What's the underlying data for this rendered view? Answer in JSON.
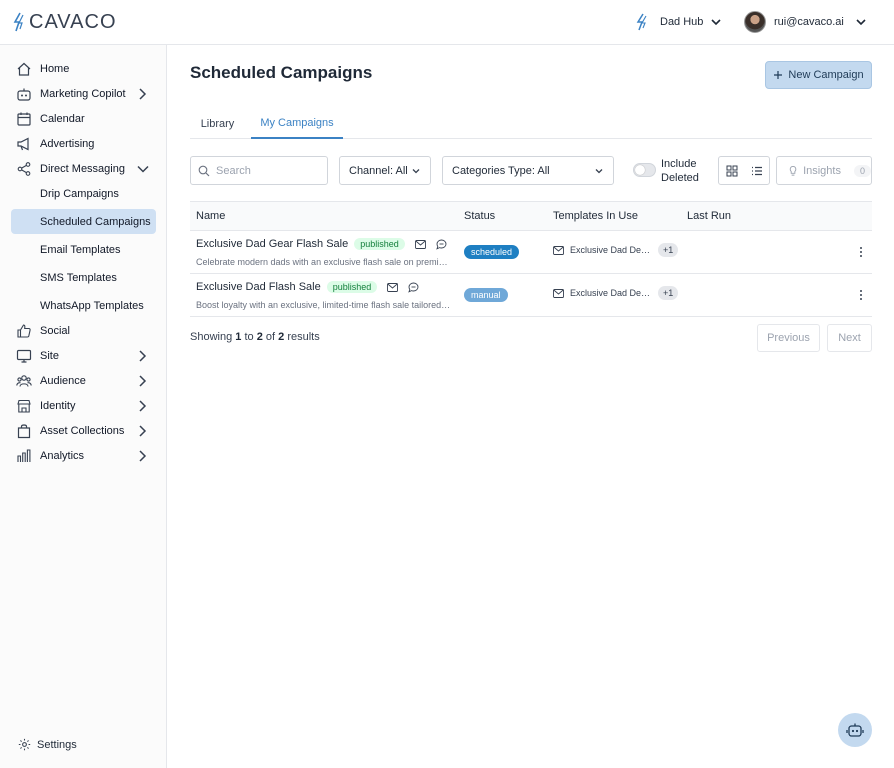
{
  "brand": {
    "name": "CAVACO",
    "accent": "#3b82c4"
  },
  "header": {
    "hub_label": "Dad Hub",
    "user_email": "rui@cavaco.ai"
  },
  "sidebar": {
    "items": [
      {
        "label": "Home",
        "icon": "home-icon"
      },
      {
        "label": "Marketing Copilot",
        "icon": "robot-icon"
      },
      {
        "label": "Calendar",
        "icon": "calendar-icon"
      },
      {
        "label": "Advertising",
        "icon": "megaphone-icon"
      },
      {
        "label": "Direct Messaging",
        "icon": "share-icon"
      },
      {
        "label": "Social",
        "icon": "thumbs-up-icon"
      },
      {
        "label": "Site",
        "icon": "monitor-icon"
      },
      {
        "label": "Audience",
        "icon": "users-icon"
      },
      {
        "label": "Identity",
        "icon": "store-icon"
      },
      {
        "label": "Asset Collections",
        "icon": "bag-icon"
      },
      {
        "label": "Analytics",
        "icon": "bar-chart-icon"
      }
    ],
    "sub_items": [
      "Drip Campaigns",
      "Scheduled Campaigns",
      "Email Templates",
      "SMS Templates",
      "WhatsApp Templates"
    ],
    "settings_label": "Settings"
  },
  "page": {
    "title": "Scheduled Campaigns",
    "new_button": "New Campaign",
    "tabs": [
      "Library",
      "My Campaigns"
    ]
  },
  "toolbar": {
    "search_placeholder": "Search",
    "channel_select": "Channel: All",
    "category_select": "Categories Type: All",
    "include_deleted": "Include Deleted",
    "insights_label": "Insights",
    "insights_count": "0"
  },
  "table": {
    "headers": [
      "Name",
      "Status",
      "Templates In Use",
      "Last Run"
    ],
    "rows": [
      {
        "name": "Exclusive Dad Gear Flash Sale",
        "badge": "published",
        "description": "Celebrate modern dads with an exclusive flash sale on premium gear",
        "status": "scheduled",
        "template": "Exclusive Dad Deals Email",
        "extra": "+1",
        "last_run": ""
      },
      {
        "name": "Exclusive Dad Flash Sale",
        "badge": "published",
        "description": "Boost loyalty with an exclusive, limited-time flash sale tailored for dads",
        "status": "manual",
        "template": "Exclusive Dad Deals Email",
        "extra": "+1",
        "last_run": ""
      }
    ]
  },
  "pagination": {
    "showing_prefix": "Showing",
    "from": "1",
    "to_word": "to",
    "to": "2",
    "of_word": "of",
    "total": "2",
    "results_word": "results",
    "previous": "Previous",
    "next": "Next"
  }
}
